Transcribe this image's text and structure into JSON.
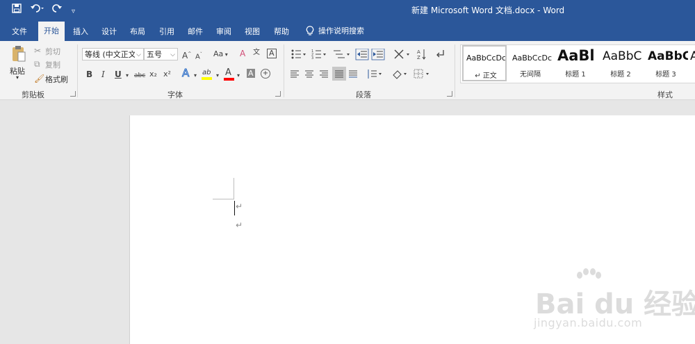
{
  "window": {
    "title": "新建 Microsoft Word 文档.docx  -  Word"
  },
  "quick_access": {
    "save_icon": "save-icon",
    "undo_icon": "undo-icon",
    "redo_icon": "redo-icon",
    "customize_icon": "customize-icon"
  },
  "tabs": [
    {
      "label": "文件"
    },
    {
      "label": "开始"
    },
    {
      "label": "插入"
    },
    {
      "label": "设计"
    },
    {
      "label": "布局"
    },
    {
      "label": "引用"
    },
    {
      "label": "邮件"
    },
    {
      "label": "审阅"
    },
    {
      "label": "视图"
    },
    {
      "label": "帮助"
    }
  ],
  "tell_me": {
    "label": "操作说明搜索",
    "icon": "lightbulb-icon"
  },
  "clipboard": {
    "group_label": "剪贴板",
    "paste_label": "粘贴",
    "cut_label": "剪切",
    "copy_label": "复制",
    "format_painter_label": "格式刷"
  },
  "font": {
    "group_label": "字体",
    "font_name": "等线 (中文正文",
    "font_size": "五号",
    "bold": "B",
    "italic": "I",
    "underline": "U",
    "strike": "abc",
    "subscript": "x₂",
    "superscript": "x²",
    "case": "Aa",
    "highlight_glyph": "ab",
    "font_color_glyph": "A",
    "phonetic_glyph": "文",
    "border_glyph": "A",
    "grow_glyph": "A",
    "shrink_glyph": "A",
    "effects_glyph": "A",
    "shading_glyph": "A",
    "enclose_glyph": "字"
  },
  "paragraph": {
    "group_label": "段落"
  },
  "styles": {
    "group_label": "样式",
    "items": [
      {
        "sample": "AaBbCcDc",
        "name": "↵ 正文"
      },
      {
        "sample": "AaBbCcDc",
        "name": "无间隔"
      },
      {
        "sample": "AaBl",
        "name": "标题 1"
      },
      {
        "sample": "AaBbC",
        "name": "标题 2"
      },
      {
        "sample": "AaBbC",
        "name": "标题 3"
      },
      {
        "sample": "A",
        "name": ""
      }
    ]
  },
  "document": {
    "para_mark": "↵"
  },
  "watermark": {
    "brand": "Bai du 经验",
    "url": "jingyan.baidu.com"
  },
  "colors": {
    "accent": "#2b579a",
    "ribbon_bg": "#f3f3f3",
    "canvas_bg": "#e6e6e6",
    "highlight": "#ffff00",
    "font_red": "#ff0000"
  }
}
